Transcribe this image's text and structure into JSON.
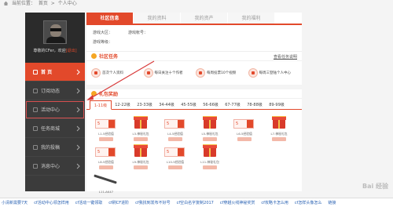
{
  "breadcrumb": {
    "prefix": "当前位置：",
    "home": "首页",
    "sep": ">",
    "current": "个人中心"
  },
  "sidebar": {
    "welcome": "尊敬的CFer，欢迎",
    "exit": "[退出]",
    "items": [
      {
        "label": "首    页"
      },
      {
        "label": "订阅动态"
      },
      {
        "label": "活动中心"
      },
      {
        "label": "任务商城"
      },
      {
        "label": "我的投稿"
      },
      {
        "label": "消息中心"
      }
    ]
  },
  "tabs": [
    "社区信息",
    "我的资料",
    "我的资产",
    "我的福利"
  ],
  "info": {
    "region": "游戏大区：",
    "account": "游戏帐号：",
    "level": "游戏等级："
  },
  "community_tasks": {
    "title": "社区任务",
    "more": "查看任务说明",
    "items": [
      "首次个人资料",
      "每日关注十个作者",
      "每周投票10个视频",
      "每周三登陆个人中心"
    ]
  },
  "gifts": {
    "title": "礼包奖励",
    "levels": [
      "1-11级",
      "12-22级",
      "23-33级",
      "34-44级",
      "45-55级",
      "56-66级",
      "67-77级",
      "78-88级",
      "89-99级"
    ],
    "coupon_mark": "5",
    "rows": [
      [
        "L1-5经验值",
        "L3-神秘礼包",
        "L4-5经验值",
        "L5-神秘礼包",
        "L6-5经验值",
        "L7-神秘礼包"
      ],
      [
        "L8-5经验值",
        "L9-神秘礼包",
        "L10-5经验值",
        "L11-神秘礼包",
        "",
        ""
      ],
      [
        "L11-AK47",
        "",
        "",
        "",
        "",
        ""
      ]
    ]
  },
  "bottom_links": [
    "小清新需要7天",
    "cf活动中心领怎样用",
    "cf活动一键领取",
    "cf刷CF进阶",
    "cf我找到发布不好号",
    "cf空白名字复制2017",
    "cf穿越火线神秘奖赏",
    "cf攻略卡怎么用",
    "cf怎样头像怎么",
    "链接"
  ],
  "watermark": "Bai 经验",
  "colors": {
    "accent": "#e2492b",
    "sidebar_bg": "#3b3b3b",
    "link": "#2a62b3"
  }
}
